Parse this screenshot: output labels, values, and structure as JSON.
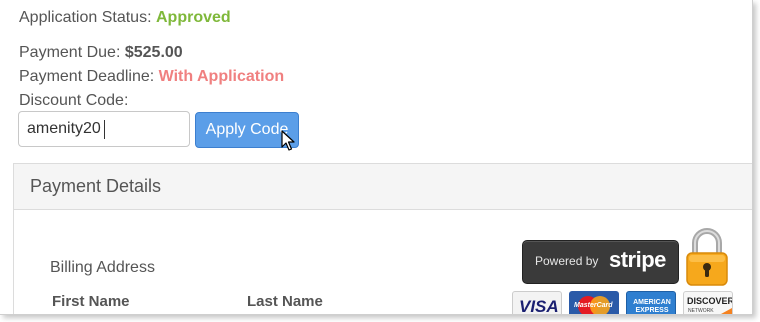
{
  "application": {
    "status_label": "Application Status:",
    "status_value": "Approved",
    "status_color": "#7fb83a"
  },
  "payment": {
    "due_label": "Payment Due:",
    "due_value": "$525.00",
    "deadline_label": "Payment Deadline:",
    "deadline_value": "With Application",
    "deadline_color": "#f08080"
  },
  "discount": {
    "label": "Discount Code:",
    "value": "amenity20",
    "button_label": "Apply Code",
    "button_color": "#5b9ee8"
  },
  "payment_details": {
    "title": "Payment Details",
    "billing_label": "Billing Address",
    "first_name_header": "First Name",
    "last_name_header": "Last Name"
  },
  "badges": {
    "stripe_prefix": "Powered by",
    "stripe_word": "stripe",
    "lock_icon": "padlock-icon",
    "cards": [
      "VISA",
      "MasterCard",
      "AMERICAN EXPRESS",
      "DISCOVER NETWORK"
    ],
    "card_visa": "VISA",
    "card_mc": "MasterCard",
    "card_amex": "AMERICAN EXPRESS",
    "card_discover": "DISCOVER",
    "card_discover_sub": "NETWORK"
  }
}
